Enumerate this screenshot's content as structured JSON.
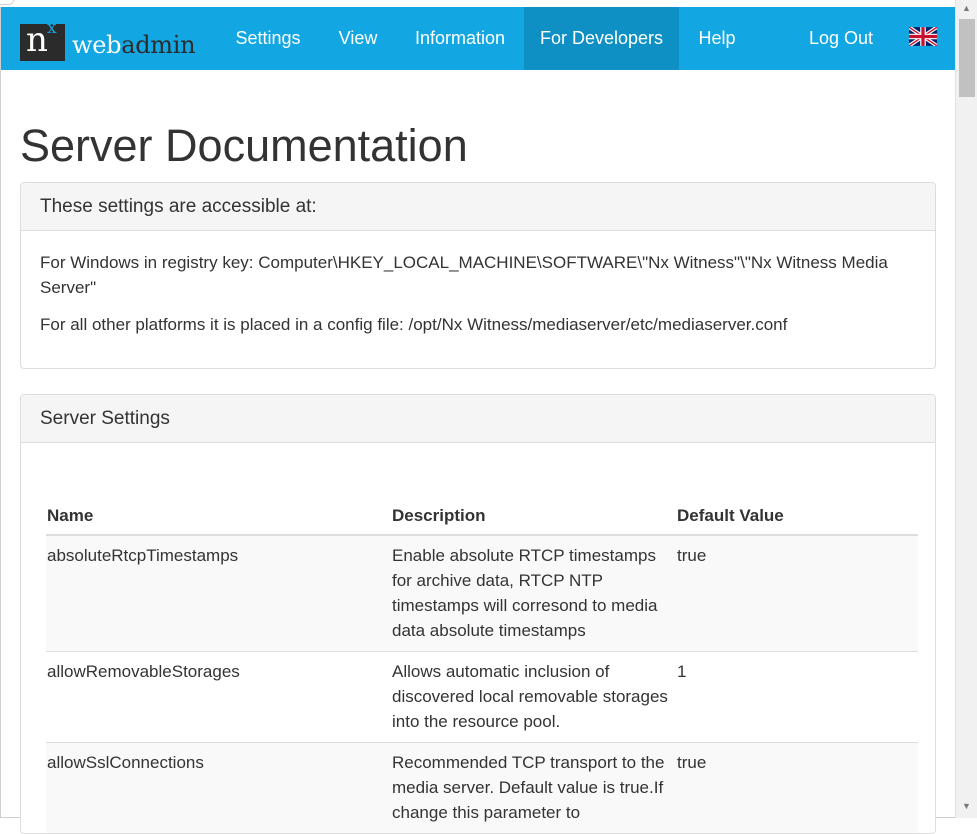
{
  "navbar": {
    "logo": {
      "n": "n",
      "x": "x",
      "web": "web",
      "admin": "admin"
    },
    "items": [
      {
        "label": "Settings"
      },
      {
        "label": "View"
      },
      {
        "label": "Information"
      },
      {
        "label": "For Developers",
        "active": true
      },
      {
        "label": "Help"
      },
      {
        "label": "Log Out"
      }
    ],
    "language_icon": "uk-flag-icon",
    "accent_color": "#12a7e2",
    "active_color": "#0e90c4"
  },
  "page_title": "Server Documentation",
  "access_panel": {
    "heading": "These settings are accessible at:",
    "windows_text": "For Windows in registry key: Computer\\HKEY_LOCAL_MACHINE\\SOFTWARE\\\"Nx Witness\"\\\"Nx Witness Media Server\"",
    "other_text": "For all other platforms it is placed in a config file: /opt/Nx Witness/mediaserver/etc/mediaserver.conf"
  },
  "settings_panel": {
    "heading": "Server Settings",
    "columns": {
      "name": "Name",
      "description": "Description",
      "default": "Default Value"
    },
    "rows": [
      {
        "name": "absoluteRtcpTimestamps",
        "description": "Enable absolute RTCP timestamps for archive data, RTCP NTP timestamps will corresond to media data absolute timestamps",
        "default": "true"
      },
      {
        "name": "allowRemovableStorages",
        "description": "Allows automatic inclusion of discovered local removable storages into the resource pool.",
        "default": "1"
      },
      {
        "name": "allowSslConnections",
        "description": "Recommended TCP transport to the media server. Default value is true.If change this parameter to",
        "default": "true"
      }
    ]
  },
  "scrollbar": {
    "up_icon": "scroll-up-arrow-icon",
    "down_icon": "scroll-down-arrow-icon"
  }
}
